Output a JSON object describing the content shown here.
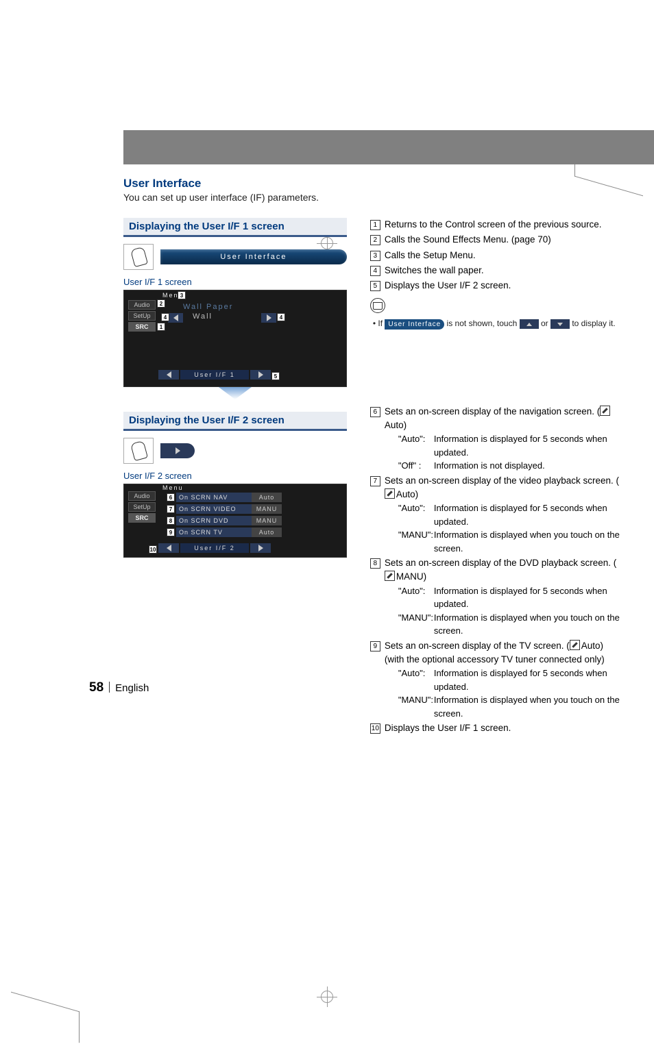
{
  "header": {
    "title": "User Interface",
    "subtitle": "You can set up user interface (IF) parameters."
  },
  "left": {
    "panel1": {
      "heading": "Displaying the User I/F 1 screen",
      "pill": "User Interface",
      "screen_label": "User I/F 1 screen",
      "tabs": {
        "audio": "Audio",
        "setup": "SetUp",
        "src": "SRC"
      },
      "menu": "Menu",
      "wallpaper_label": "Wall Paper",
      "wall_btn": "Wall",
      "footer_btn": "User I/F 1"
    },
    "panel2": {
      "heading": "Displaying the User I/F 2 screen",
      "screen_label": "User I/F 2 screen",
      "tabs": {
        "audio": "Audio",
        "setup": "SetUp",
        "src": "SRC"
      },
      "menu": "Menu",
      "rows": [
        {
          "n": "6",
          "label": "On SCRN NAV",
          "val": "Auto"
        },
        {
          "n": "7",
          "label": "On SCRN VIDEO",
          "val": "MANU"
        },
        {
          "n": "8",
          "label": "On SCRN DVD",
          "val": "MANU"
        },
        {
          "n": "9",
          "label": "On SCRN TV",
          "val": "Auto"
        }
      ],
      "footer_btn": "User I/F 2"
    }
  },
  "right": {
    "list1": [
      {
        "n": "1",
        "t": "Returns to the Control screen of the previous source."
      },
      {
        "n": "2",
        "t": "Calls the Sound Effects Menu. (page 70)"
      },
      {
        "n": "3",
        "t": "Calls the Setup Menu."
      },
      {
        "n": "4",
        "t": "Switches the wall paper."
      },
      {
        "n": "5",
        "t": "Displays the User I/F 2 screen."
      }
    ],
    "note": {
      "pre": "If",
      "btn": "User Interface",
      "mid": "is not shown, touch",
      "or": "or",
      "post": "to display it."
    },
    "list2": [
      {
        "n": "6",
        "lead": "Sets an on-screen display of the navigation screen.",
        "def": "Auto",
        "defs": [
          {
            "k": "\"Auto\":",
            "v": "Information is displayed for 5 seconds when updated."
          },
          {
            "k": "\"Off\" :",
            "v": "Information is not displayed."
          }
        ]
      },
      {
        "n": "7",
        "lead": "Sets an on-screen display of the video playback screen.",
        "def": "Auto",
        "defs": [
          {
            "k": "\"Auto\":",
            "v": "Information is displayed for 5 seconds when updated."
          },
          {
            "k": "\"MANU\":",
            "v": "Information is displayed when you touch on the screen."
          }
        ]
      },
      {
        "n": "8",
        "lead": "Sets an on-screen display of the DVD playback screen.",
        "def": "MANU",
        "defs": [
          {
            "k": "\"Auto\":",
            "v": "Information is displayed for 5 seconds when updated."
          },
          {
            "k": "\"MANU\":",
            "v": "Information is displayed when you touch on the screen."
          }
        ]
      },
      {
        "n": "9",
        "lead": "Sets an on-screen display of the TV screen.",
        "def": "Auto",
        "trail": "(with the optional accessory TV tuner connected only)",
        "defs": [
          {
            "k": "\"Auto\":",
            "v": "Information is displayed for 5 seconds when updated."
          },
          {
            "k": "\"MANU\":",
            "v": "Information is displayed when you touch on the screen."
          }
        ]
      },
      {
        "n": "10",
        "lead": "Displays the User I/F 1 screen."
      }
    ]
  },
  "footer": {
    "page": "58",
    "lang": "English"
  }
}
